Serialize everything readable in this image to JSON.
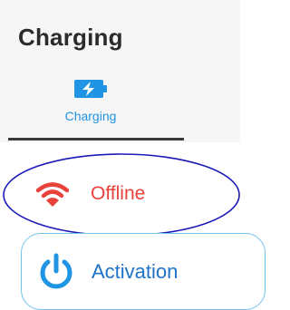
{
  "header": {
    "title": "Charging",
    "background": "#f6f6f6"
  },
  "tabs": [
    {
      "label": "Charging",
      "icon": "battery-charging-icon",
      "active": true,
      "color": "#1f95e3"
    }
  ],
  "status": {
    "label": "Offline",
    "icon": "wifi-icon",
    "color": "#e8423a",
    "highlighted": true,
    "highlight_color": "#1a1ab8"
  },
  "activation_button": {
    "label": "Activation",
    "icon": "power-icon",
    "label_color": "#1e73c8",
    "border_color": "#74c2ee",
    "icon_color": "#1f95e3"
  }
}
